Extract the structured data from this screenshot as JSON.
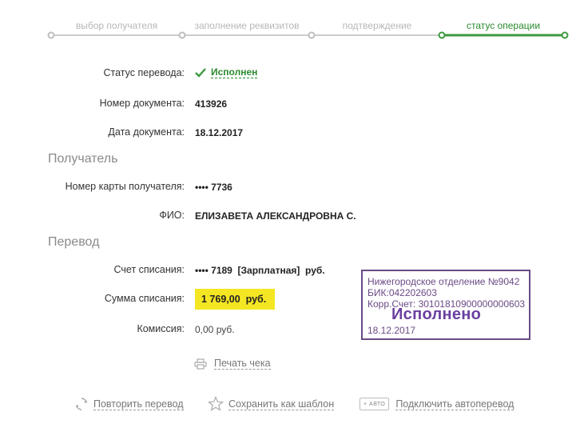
{
  "steps": [
    {
      "label": "выбор получателя",
      "active": false
    },
    {
      "label": "заполнение реквизитов",
      "active": false
    },
    {
      "label": "подтверждение",
      "active": false
    },
    {
      "label": "статус операции",
      "active": true
    }
  ],
  "details": {
    "status_label": "Статус перевода:",
    "status_value": "Исполнен",
    "doc_number_label": "Номер документа:",
    "doc_number_value": "413926",
    "doc_date_label": "Дата документа:",
    "doc_date_value": "18.12.2017"
  },
  "recipient": {
    "section_title": "Получатель",
    "card_label": "Номер карты получателя:",
    "card_value": "•••• 7736",
    "name_label": "ФИО:",
    "name_value": "ЕЛИЗАВЕТА АЛЕКСАНДРОВНА С."
  },
  "transfer": {
    "section_title": "Перевод",
    "account_label": "Счет списания:",
    "account_value": "•••• 7189  [Зарплатная]  руб.",
    "amount_label": "Сумма списания:",
    "amount_value": "1 769,00  руб.",
    "fee_label": "Комиссия:",
    "fee_value": "0,00 руб."
  },
  "stamp": {
    "line1": "Нижегородское отделение №9042",
    "line2": "БИК:042202603",
    "line3": "Корр.Счет: 30101810900000000603",
    "status": "Исполнено",
    "date": "18.12.2017"
  },
  "actions": {
    "print_receipt": "Печать чека",
    "repeat_transfer": "Повторить перевод",
    "save_template": "Сохранить как шаблон",
    "auto_badge": "+ АВТО",
    "connect_auto": "Подключить автоперевод"
  },
  "colors": {
    "accent_green": "#2b8a2e",
    "highlight_yellow": "#f5e623",
    "stamp_purple": "#6a4a86"
  }
}
